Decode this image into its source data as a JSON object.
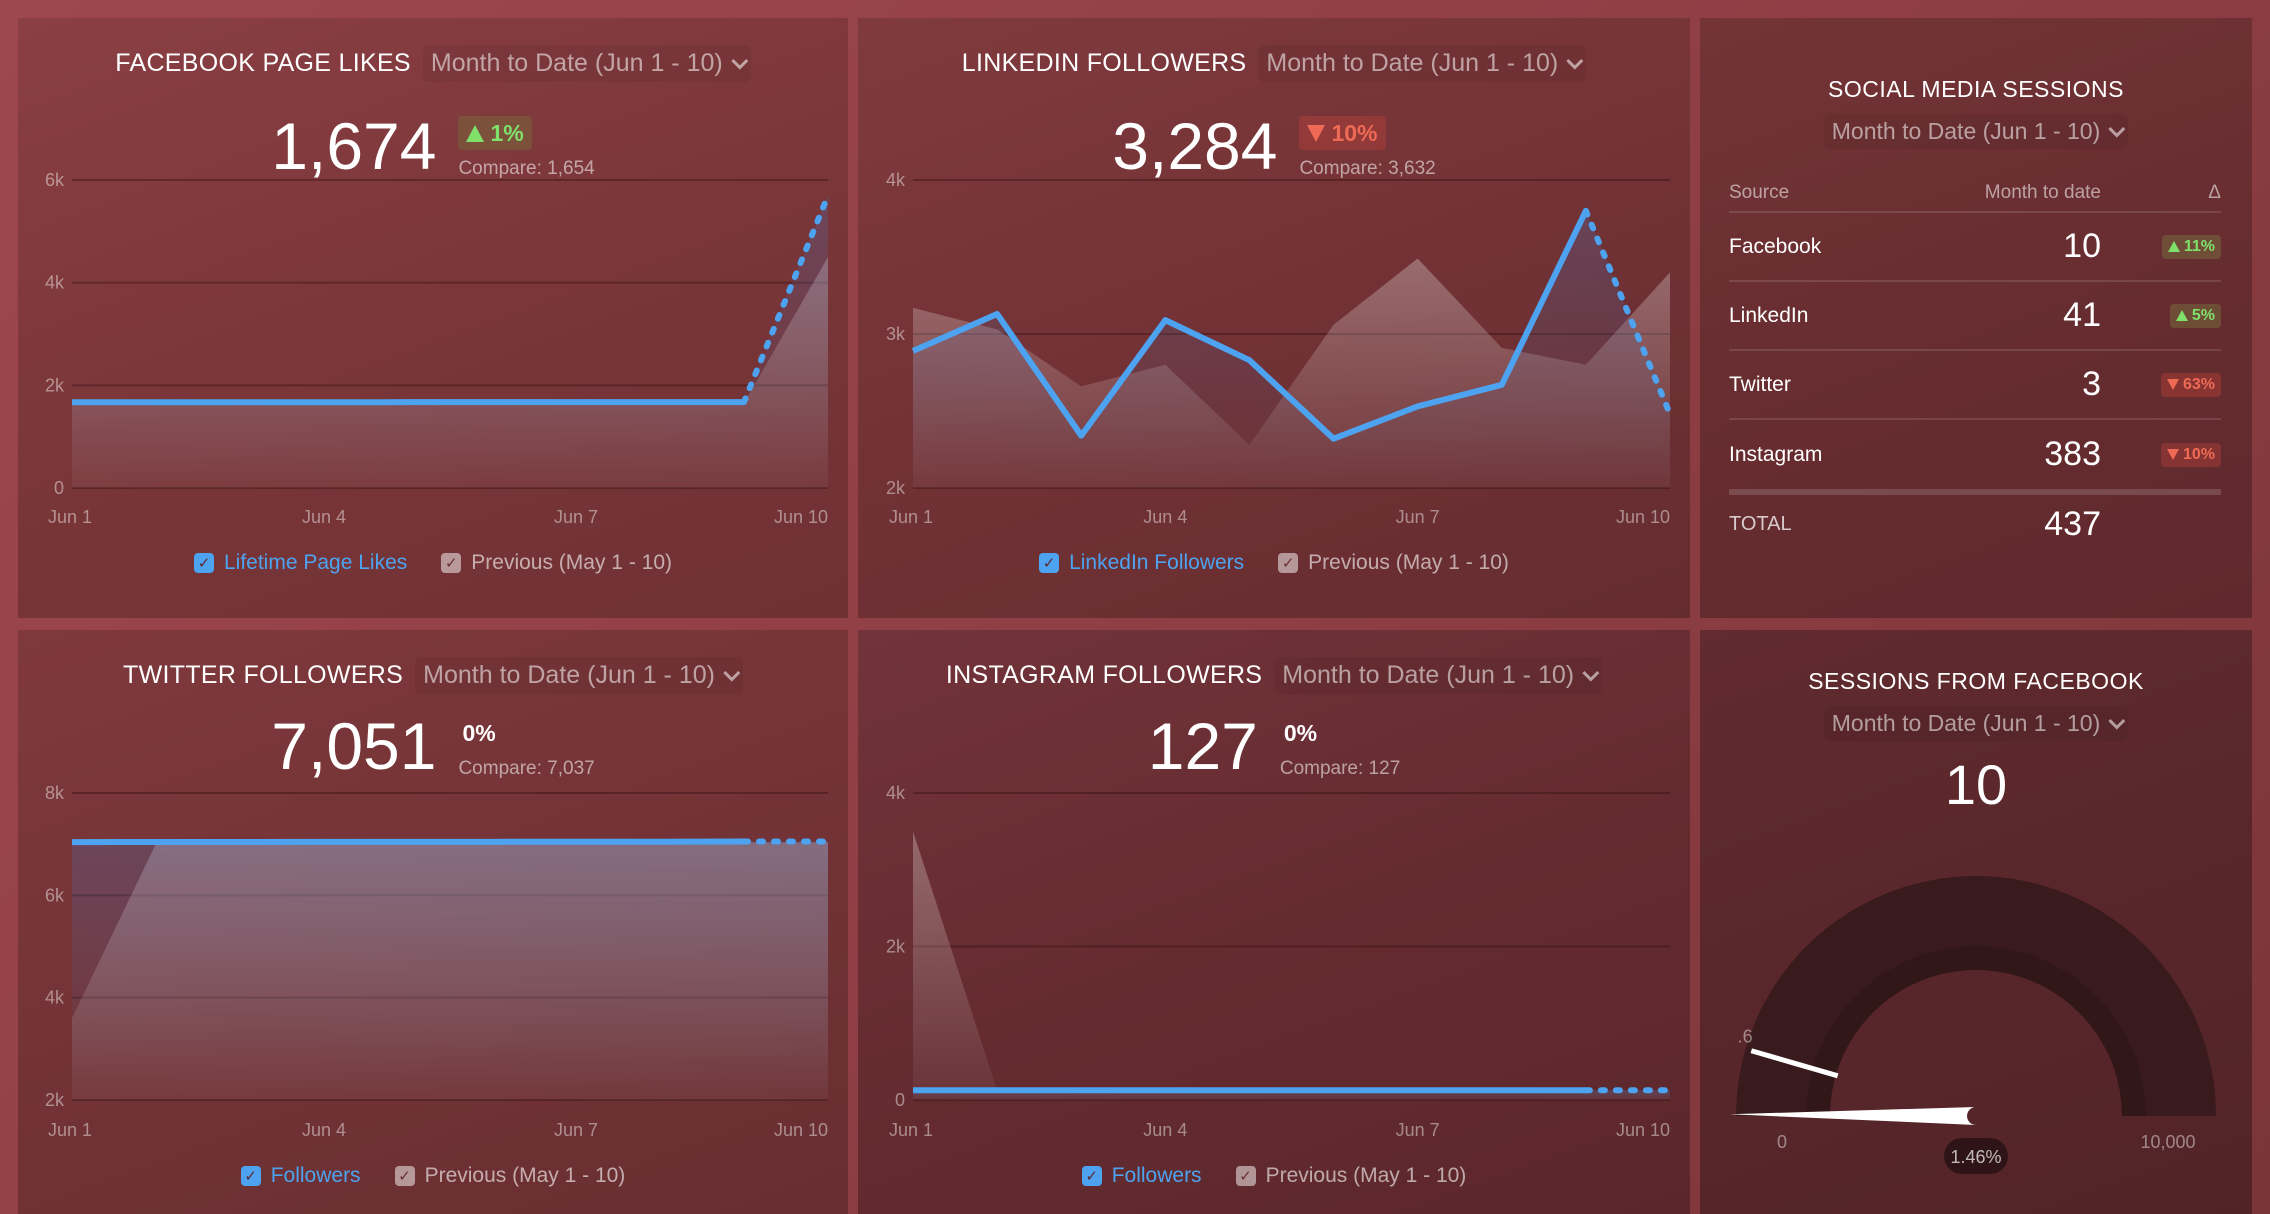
{
  "colors": {
    "series_current": "#4da3f0",
    "series_previous": "rgba(255,255,255,0.25)",
    "badge_up": "#7fe06a",
    "badge_down": "#ee6a55"
  },
  "widgets": {
    "facebook": {
      "title": "FACEBOOK PAGE LIKES",
      "range_label": "Month to Date (Jun 1 - 10)",
      "value": "1,674",
      "delta": "1%",
      "delta_direction": "up",
      "compare": "Compare: 1,654",
      "legend_current": "Lifetime Page Likes",
      "legend_previous": "Previous (May 1 - 10)"
    },
    "linkedin": {
      "title": "LINKEDIN FOLLOWERS",
      "range_label": "Month to Date (Jun 1 - 10)",
      "value": "3,284",
      "delta": "10%",
      "delta_direction": "down",
      "compare": "Compare: 3,632",
      "legend_current": "LinkedIn Followers",
      "legend_previous": "Previous (May 1 - 10)"
    },
    "twitter": {
      "title": "TWITTER FOLLOWERS",
      "range_label": "Month to Date (Jun 1 - 10)",
      "value": "7,051",
      "delta": "0%",
      "delta_direction": "flat",
      "compare": "Compare: 7,037",
      "legend_current": "Followers",
      "legend_previous": "Previous (May 1 - 10)"
    },
    "instagram": {
      "title": "INSTAGRAM FOLLOWERS",
      "range_label": "Month to Date (Jun 1 - 10)",
      "value": "127",
      "delta": "0%",
      "delta_direction": "flat",
      "compare": "Compare: 127",
      "legend_current": "Followers",
      "legend_previous": "Previous (May 1 - 10)"
    },
    "social_sessions": {
      "title": "SOCIAL MEDIA SESSIONS",
      "range_label": "Month to Date (Jun 1 - 10)",
      "columns": [
        "Source",
        "Month to date",
        "Δ"
      ],
      "rows": [
        {
          "source": "Facebook",
          "value": "10",
          "delta": "11%",
          "direction": "up"
        },
        {
          "source": "LinkedIn",
          "value": "41",
          "delta": "5%",
          "direction": "up"
        },
        {
          "source": "Twitter",
          "value": "3",
          "delta": "63%",
          "direction": "down"
        },
        {
          "source": "Instagram",
          "value": "383",
          "delta": "10%",
          "direction": "down"
        }
      ],
      "total_label": "TOTAL",
      "total_value": "437"
    },
    "sessions_facebook": {
      "title": "SESSIONS FROM FACEBOOK",
      "range_label": "Month to Date (Jun 1 - 10)",
      "value": "10",
      "gauge_min_label": "0",
      "gauge_max_label": "10,000",
      "gauge_min": 0,
      "gauge_max": 10000,
      "gauge_value": 10,
      "gauge_percent_label": "1.46%",
      "target_marker_label": ".6",
      "target_marker_fraction": 0.09
    }
  },
  "chart_data": [
    {
      "id": "facebook",
      "type": "line",
      "title": "FACEBOOK PAGE LIKES",
      "x": [
        "Jun 1",
        "Jun 2",
        "Jun 3",
        "Jun 4",
        "Jun 5",
        "Jun 6",
        "Jun 7",
        "Jun 8",
        "Jun 9",
        "Jun 10"
      ],
      "xticks": [
        "Jun 1",
        "Jun 4",
        "Jun 7",
        "Jun 10"
      ],
      "yticks": [
        "0",
        "2k",
        "4k",
        "6k"
      ],
      "ylim": [
        0,
        6000
      ],
      "grid": true,
      "legend": "bottom",
      "series": [
        {
          "name": "Lifetime Page Likes",
          "values": [
            1670,
            1670,
            1670,
            1670,
            1672,
            1672,
            1673,
            1673,
            1674,
            5700
          ],
          "dashed_last": true
        },
        {
          "name": "Previous (May 1 - 10)",
          "values": [
            1650,
            1650,
            1650,
            1651,
            1651,
            1652,
            1652,
            1653,
            1654,
            4500
          ],
          "area": true
        }
      ]
    },
    {
      "id": "linkedin",
      "type": "line",
      "title": "LINKEDIN FOLLOWERS",
      "x": [
        "Jun 1",
        "Jun 2",
        "Jun 3",
        "Jun 4",
        "Jun 5",
        "Jun 6",
        "Jun 7",
        "Jun 8",
        "Jun 9",
        "Jun 10"
      ],
      "xticks": [
        "Jun 1",
        "Jun 4",
        "Jun 7",
        "Jun 10"
      ],
      "yticks": [
        "2k",
        "3k",
        "4k"
      ],
      "ylim": [
        2000,
        4000
      ],
      "grid": true,
      "legend": "bottom",
      "series": [
        {
          "name": "LinkedIn Followers",
          "values": [
            2890,
            3130,
            2340,
            3090,
            2830,
            2320,
            2530,
            2670,
            3800,
            2480
          ],
          "dashed_last": true
        },
        {
          "name": "Previous (May 1 - 10)",
          "values": [
            3170,
            3030,
            2660,
            2800,
            2280,
            3060,
            3490,
            2910,
            2800,
            3400
          ],
          "area": true
        }
      ]
    },
    {
      "id": "twitter",
      "type": "line",
      "title": "TWITTER FOLLOWERS",
      "x": [
        "Jun 1",
        "Jun 2",
        "Jun 3",
        "Jun 4",
        "Jun 5",
        "Jun 6",
        "Jun 7",
        "Jun 8",
        "Jun 9",
        "Jun 10"
      ],
      "xticks": [
        "Jun 1",
        "Jun 4",
        "Jun 7",
        "Jun 10"
      ],
      "yticks": [
        "2k",
        "4k",
        "6k",
        "8k"
      ],
      "ylim": [
        2000,
        8000
      ],
      "grid": true,
      "legend": "bottom",
      "series": [
        {
          "name": "Followers",
          "values": [
            7040,
            7042,
            7043,
            7044,
            7045,
            7046,
            7047,
            7048,
            7051,
            7051
          ],
          "dashed_last": true
        },
        {
          "name": "Previous (May 1 - 10)",
          "values": [
            3600,
            7010,
            7015,
            7018,
            7020,
            7024,
            7028,
            7031,
            7034,
            7037
          ],
          "area": true
        }
      ]
    },
    {
      "id": "instagram",
      "type": "line",
      "title": "INSTAGRAM FOLLOWERS",
      "x": [
        "Jun 1",
        "Jun 2",
        "Jun 3",
        "Jun 4",
        "Jun 5",
        "Jun 6",
        "Jun 7",
        "Jun 8",
        "Jun 9",
        "Jun 10"
      ],
      "xticks": [
        "Jun 1",
        "Jun 4",
        "Jun 7",
        "Jun 10"
      ],
      "yticks": [
        "0",
        "2k",
        "4k"
      ],
      "ylim": [
        0,
        4000
      ],
      "grid": true,
      "legend": "bottom",
      "series": [
        {
          "name": "Followers",
          "values": [
            127,
            127,
            127,
            127,
            127,
            127,
            127,
            127,
            127,
            127
          ],
          "dashed_last": true
        },
        {
          "name": "Previous (May 1 - 10)",
          "values": [
            3500,
            127,
            127,
            127,
            127,
            127,
            127,
            127,
            127,
            127
          ],
          "area": true
        }
      ]
    }
  ]
}
